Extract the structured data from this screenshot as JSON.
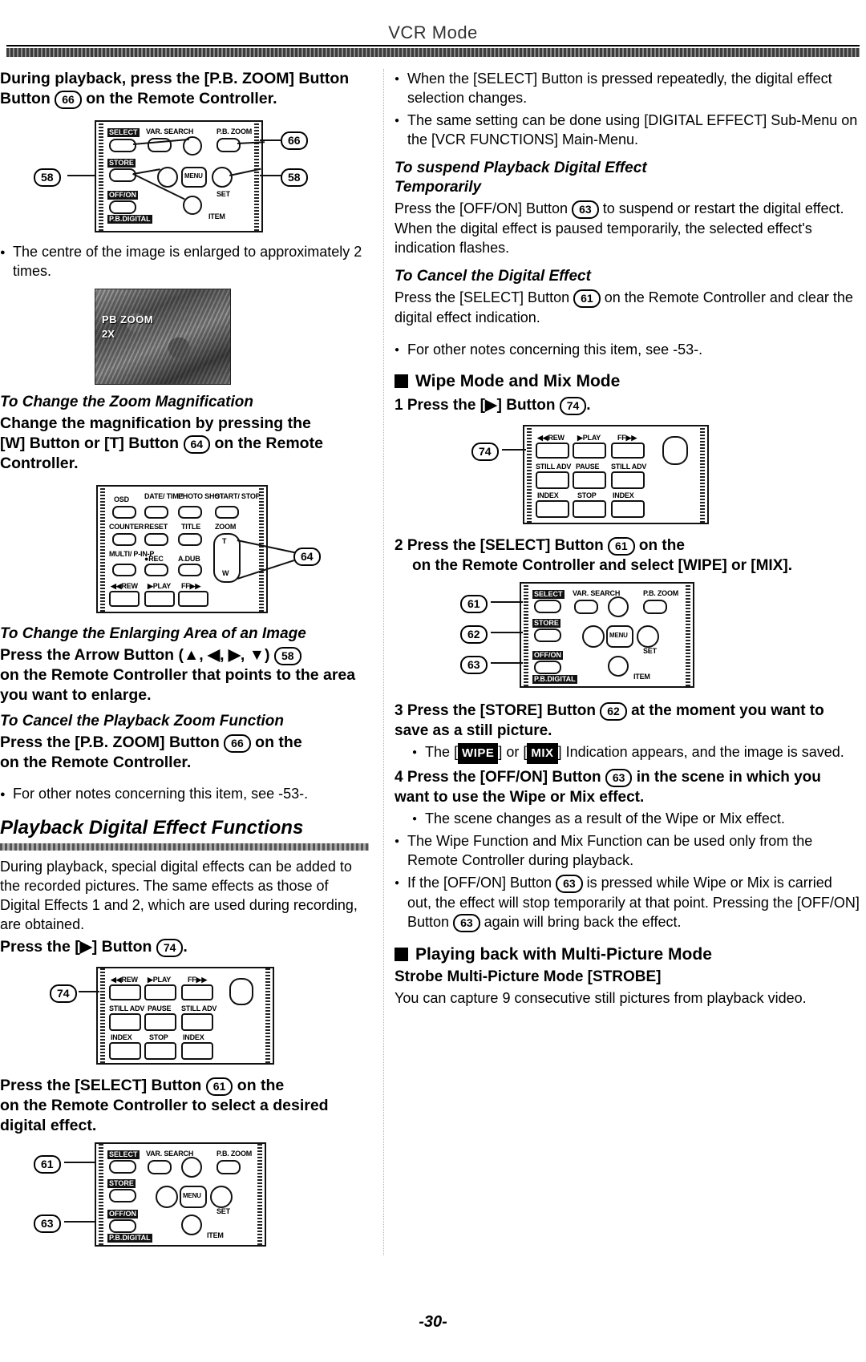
{
  "header": {
    "title": "VCR Mode"
  },
  "page_number": "-30-",
  "left_column": {
    "instruction_1": "During playback, press the [P.B. ZOOM] Button",
    "instruction_1_cont": "on the Remote Controller.",
    "ref_66": "66",
    "ref_58": "58",
    "note_centre": "The centre of the image is enlarged to approximately 2 times.",
    "screen_label_1": "PB ZOOM",
    "screen_label_2": "2X",
    "zoom_mag_heading": "To Change the Zoom Magnification",
    "zoom_mag_body_a": "Change the magnification by pressing the",
    "zoom_mag_body_b": "[W] Button or [T] Button",
    "zoom_mag_body_c": "on the Remote",
    "zoom_mag_body_d": "Controller.",
    "ref_64": "64",
    "enlarge_area_heading": "To Change the Enlarging Area of an Image",
    "enlarge_area_body_a": "Press the Arrow Button (▲, ◀, ▶, ▼)",
    "enlarge_area_body_b": "on the Remote Controller that points to the area you want to enlarge.",
    "cancel_zoom_heading": "To Cancel the Playback Zoom Function",
    "cancel_zoom_body_a": "Press the [P.B. ZOOM] Button",
    "cancel_zoom_body_b": "on the Remote Controller.",
    "other_notes": "For other notes concerning this item, see -53-.",
    "section_title": "Playback Digital Effect Functions",
    "section_body": "During playback, special digital effects can be added to the recorded pictures. The same effects as those of Digital Effects 1 and 2, which are used during recording, are obtained.",
    "step_1": "Press the [▶] Button",
    "ref_74": "74",
    "step_2_a": "Press the [SELECT] Button",
    "step_2_b": "on the Remote Controller to select a desired digital effect.",
    "ref_61": "61",
    "ref_63": "63",
    "ref_62": "62"
  },
  "right_column": {
    "bullet_1": "When the [SELECT] Button is pressed repeatedly, the digital effect selection changes.",
    "bullet_2": "The same setting can be done using [DIGITAL EFFECT] Sub-Menu on the [VCR FUNCTIONS] Main-Menu.",
    "suspend_heading_l1": "To suspend Playback Digital Effect",
    "suspend_heading_l2": "Temporarily",
    "suspend_body_a": "Press the [OFF/ON] Button",
    "suspend_body_b": "to suspend or restart the digital effect. When the digital effect is paused temporarily, the selected effect's indication flashes.",
    "cancel_heading": "To Cancel the Digital Effect",
    "cancel_body_a": "Press the [SELECT] Button",
    "cancel_body_b": "on the Remote Controller and clear the digital effect indication.",
    "other_notes": "For other notes concerning this item, see -53-.",
    "wipe_mix_heading": "Wipe Mode and Mix Mode",
    "step1": "1",
    "step1_text": "Press the [▶] Button",
    "step2": "2",
    "step2_text_a": "Press the [SELECT] Button",
    "step2_text_b": "on the Remote Controller and select [WIPE] or [MIX].",
    "step3": "3",
    "step3_text_a": "Press the [STORE] Button",
    "step3_text_b": "at the moment you want to save as a still picture.",
    "step3_bullet_a": "The [",
    "step3_bullet_wipe": "WIPE",
    "step3_bullet_b": "] or [",
    "step3_bullet_mix": "MIX",
    "step3_bullet_c": "] Indication appears, and the image is saved.",
    "step4": "4",
    "step4_text_a": "Press the [OFF/ON] Button",
    "step4_text_b": "in the scene in which you want to use the Wipe or Mix effect.",
    "step4_bullet": "The scene changes as a result of the Wipe or Mix effect.",
    "bullet_3": "The Wipe Function and Mix Function can be used only from the Remote Controller during playback.",
    "bullet_4_a": "If the [OFF/ON] Button",
    "bullet_4_b": "is pressed while Wipe or Mix is carried out, the effect will stop temporarily at that point. Pressing the [OFF/ON] Button",
    "bullet_4_c": "again will bring back the effect.",
    "multipic_heading": "Playing back with Multi-Picture Mode",
    "strobe_heading": "Strobe Multi-Picture Mode [STROBE]",
    "strobe_body": "You can capture 9 consecutive still pictures from playback video.",
    "ref_63": "63",
    "ref_61": "61",
    "ref_62": "62",
    "ref_74": "74"
  },
  "remote_labels": {
    "select": "SELECT",
    "store": "STORE",
    "offon": "OFF/ON",
    "pbdigital": "P.B.DIGITAL",
    "var_search": "VAR. SEARCH",
    "pb_zoom": "P.B. ZOOM",
    "menu": "MENU",
    "set": "SET",
    "item": "ITEM",
    "osd": "OSD",
    "date_time": "DATE/ TIME",
    "photo_shot": "PHOTO SHOT",
    "start_stop": "START/ STOP",
    "counter": "COUNTER",
    "reset": "RESET",
    "title": "TITLE",
    "zoom": "ZOOM",
    "multi_pinp": "MULTI/ P-IN-P",
    "rec": "●REC",
    "adub": "A.DUB",
    "rew": "◀◀REW",
    "play": "▶PLAY",
    "ff": "FF▶▶",
    "t": "T",
    "w": "W",
    "still_adv": "STILL ADV",
    "pause": "PAUSE",
    "index": "INDEX",
    "stop": "STOP"
  }
}
